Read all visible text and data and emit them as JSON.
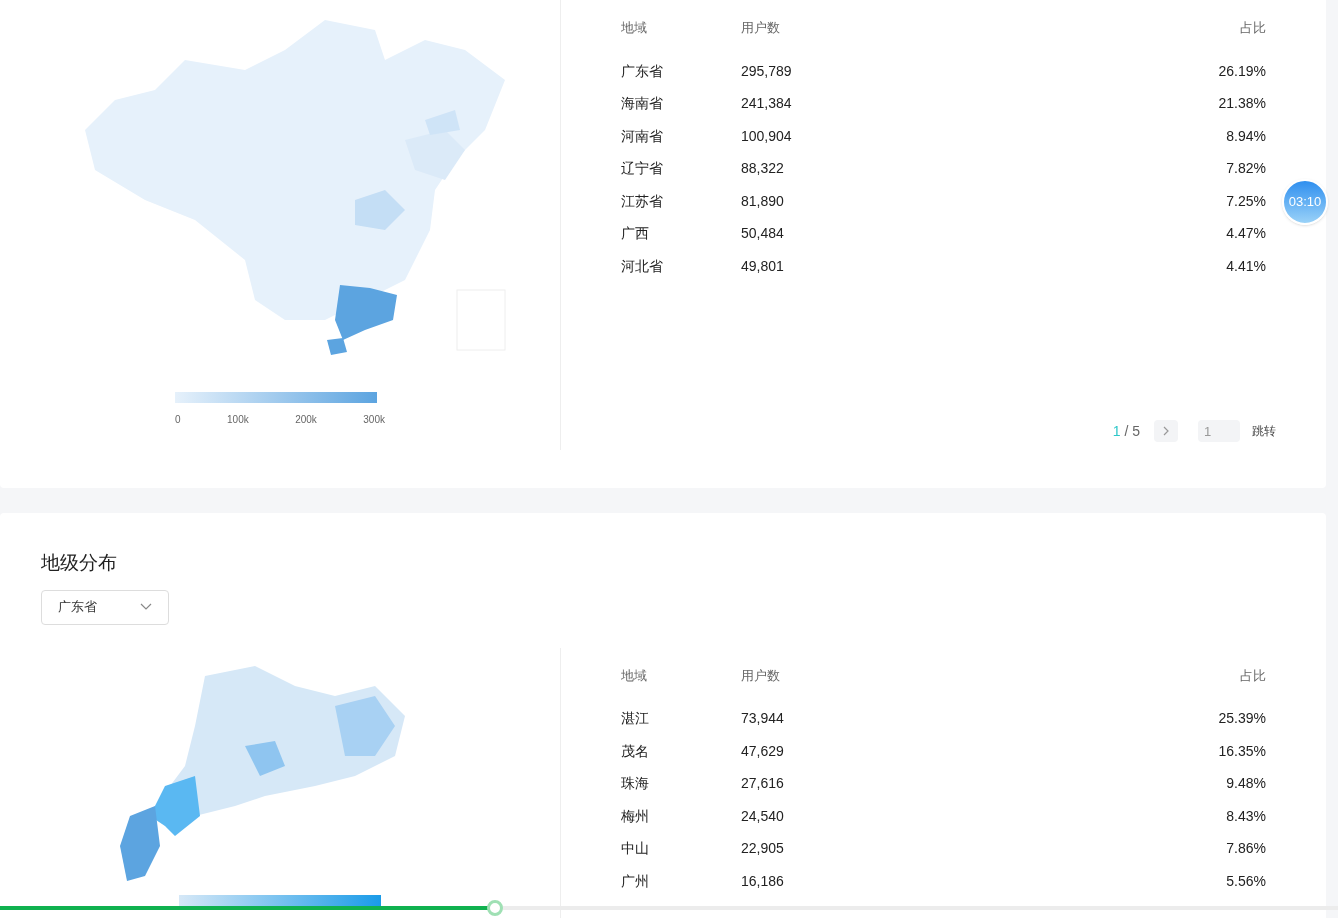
{
  "national": {
    "legend_ticks": [
      "0",
      "100k",
      "200k",
      "300k"
    ],
    "table": {
      "columns": [
        "地域",
        "用户数",
        "占比"
      ],
      "rows": [
        {
          "region": "广东省",
          "users": "295,789",
          "share": "26.19%"
        },
        {
          "region": "海南省",
          "users": "241,384",
          "share": "21.38%"
        },
        {
          "region": "河南省",
          "users": "100,904",
          "share": "8.94%"
        },
        {
          "region": "辽宁省",
          "users": "88,322",
          "share": "7.82%"
        },
        {
          "region": "江苏省",
          "users": "81,890",
          "share": "7.25%"
        },
        {
          "region": "广西",
          "users": "50,484",
          "share": "4.47%"
        },
        {
          "region": "河北省",
          "users": "49,801",
          "share": "4.41%"
        }
      ]
    },
    "pagination": {
      "current": "1",
      "separator": "/",
      "total": "5",
      "jump_value": "1",
      "jump_label": "跳转"
    }
  },
  "city": {
    "title": "地级分布",
    "select": {
      "value": "广东省"
    },
    "table": {
      "columns": [
        "地域",
        "用户数",
        "占比"
      ],
      "rows": [
        {
          "region": "湛江",
          "users": "73,944",
          "share": "25.39%"
        },
        {
          "region": "茂名",
          "users": "47,629",
          "share": "16.35%"
        },
        {
          "region": "珠海",
          "users": "27,616",
          "share": "9.48%"
        },
        {
          "region": "梅州",
          "users": "24,540",
          "share": "8.43%"
        },
        {
          "region": "中山",
          "users": "22,905",
          "share": "7.86%"
        },
        {
          "region": "广州",
          "users": "16,186",
          "share": "5.56%"
        }
      ]
    }
  },
  "timer": {
    "text": "03:10"
  },
  "playback": {
    "level": 0.37
  }
}
